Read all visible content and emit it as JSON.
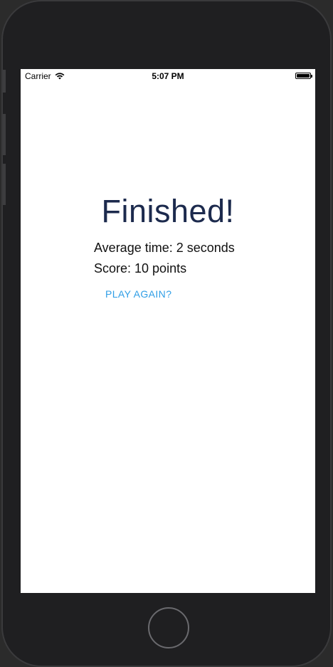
{
  "status_bar": {
    "carrier": "Carrier",
    "time": "5:07 PM",
    "battery_level": 1.0
  },
  "main": {
    "title": "Finished!",
    "average_time": "Average time: 2 seconds",
    "score": "Score: 10 points",
    "play_again_label": "PLAY AGAIN?"
  },
  "colors": {
    "title": "#1c2a4d",
    "link": "#2f9ee6",
    "device_frame": "#1f1f21",
    "screen_bg": "#ffffff"
  },
  "icons": {
    "wifi": "wifi-icon",
    "battery": "battery-icon",
    "home": "home-button"
  }
}
